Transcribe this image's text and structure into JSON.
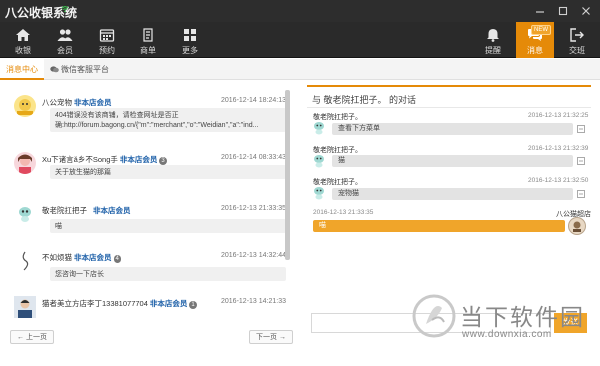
{
  "window": {
    "title": "八公收银系统",
    "controls": [
      "minimize-icon",
      "maximize-icon",
      "close-icon"
    ]
  },
  "toolbar": {
    "items": [
      {
        "label": "收银",
        "icon": "home-icon"
      },
      {
        "label": "会员",
        "icon": "members-icon"
      },
      {
        "label": "预约",
        "icon": "calendar-icon"
      },
      {
        "label": "商单",
        "icon": "order-icon"
      },
      {
        "label": "更多",
        "icon": "more-icon"
      }
    ],
    "right_items": [
      {
        "label": "提醒",
        "icon": "bell-icon"
      },
      {
        "label": "消息",
        "icon": "chat-icon",
        "badge": "NEW",
        "active": true
      },
      {
        "label": "交班",
        "icon": "logout-icon"
      }
    ],
    "active_color": "#e58a08"
  },
  "tabs": [
    {
      "label": "消息中心",
      "active": true
    },
    {
      "label": "微信客服平台",
      "icon": "chat-bubble-icon"
    }
  ],
  "messages": [
    {
      "name": "八公宠物",
      "member": "非本店会员",
      "time": "2016-12-14 18:24:13",
      "lines": [
        "404错误没有该商铺，请检查网址是否正",
        "确:http://forum.bagong.cn/{\"m\":\"merchant\",\"o\":\"Weidian\",\"a\":\"ind..."
      ]
    },
    {
      "name": "Xu下诸言ǎ乡不Song手",
      "member": "非本店会员",
      "count": "3",
      "time": "2016-12-14 08:33:43",
      "lines": [
        "关于放生猫的那篇"
      ]
    },
    {
      "name": "敬老院扛把子",
      "member": "非本店会员",
      "time": "2016-12-13 21:33:35",
      "lines": [
        "喵"
      ]
    },
    {
      "name": "不如烦猫",
      "member": "非本店会员",
      "count": "4",
      "time": "2016-12-13 14:32:44",
      "lines": [
        "您咨询一下店长"
      ]
    },
    {
      "name": "猫者美立方店李丁13381077704",
      "member": "非本店会员",
      "count": "1",
      "time": "2016-12-13 14:21:33",
      "lines": []
    }
  ],
  "pager": {
    "prev": "← 上一页",
    "next": "下一页 →"
  },
  "chat": {
    "title": "与 敬老院扛把子。 的对话",
    "entries": [
      {
        "name": "敬老院扛把子。",
        "time": "2016-12-13 21:32:25",
        "text": "查看下方菜单",
        "mine": false
      },
      {
        "name": "敬老院扛把子。",
        "time": "2016-12-13 21:32:39",
        "text": "猫",
        "mine": false
      },
      {
        "name": "敬老院扛把子。",
        "time": "2016-12-13 21:32:50",
        "text": "宠物猫",
        "mine": false
      },
      {
        "name": "八公猫超店",
        "time": "2016-12-13 21:33:35",
        "text": "喵",
        "mine": true
      }
    ],
    "send": "发送",
    "input_value": ""
  },
  "watermark": {
    "text": "当下软件园",
    "url": "www.downxia.com"
  }
}
